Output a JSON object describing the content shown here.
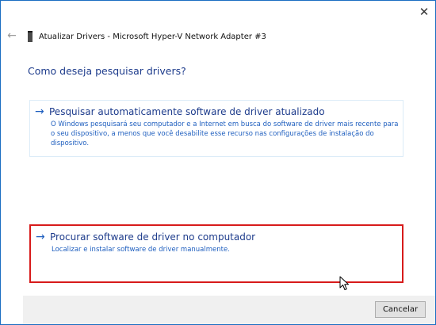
{
  "header": {
    "close_glyph": "✕",
    "back_glyph": "←",
    "title": "Atualizar Drivers - Microsoft Hyper-V Network Adapter #3"
  },
  "question": "Como deseja pesquisar drivers?",
  "options": [
    {
      "arrow": "→",
      "title": "Pesquisar automaticamente software de driver atualizado",
      "description": "O Windows pesquisará seu computador e a Internet em busca do software de driver mais recente para o seu dispositivo, a menos que você desabilite esse recurso nas configurações de instalação do dispositivo.",
      "highlighted": false
    },
    {
      "arrow": "→",
      "title": "Procurar software de driver no computador",
      "description": "Localizar e instalar software de driver manualmente.",
      "highlighted": true,
      "highlight_color": "#d71b1b"
    }
  ],
  "footer": {
    "cancel_label": "Cancelar"
  },
  "colors": {
    "link": "#1e3c8c",
    "accent": "#1f5fbf"
  }
}
